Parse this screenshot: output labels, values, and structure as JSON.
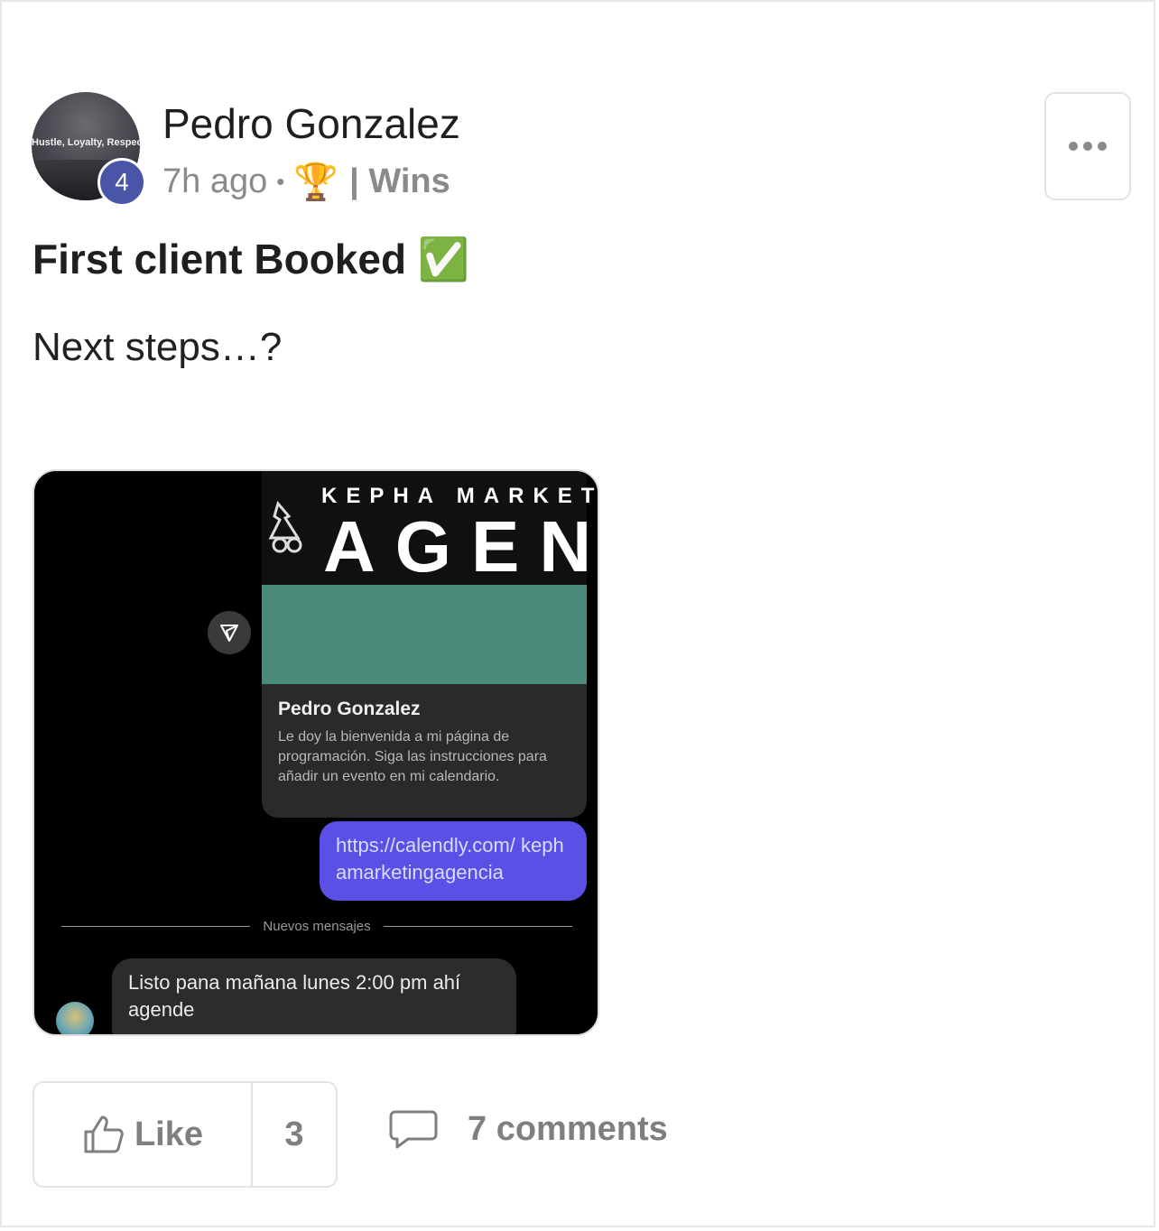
{
  "post": {
    "author": "Pedro Gonzalez",
    "avatar_text": "Hustle, Loyalty, Respect",
    "level": "4",
    "time": "7h ago",
    "separator": "•",
    "category_icon": "🏆",
    "category": "| Wins",
    "title": "First client Booked ✅",
    "body": "Next steps…?"
  },
  "attachment": {
    "banner_small": "KEPHA MARKETING",
    "banner_big": "AGENCY",
    "card_name": "Pedro Gonzalez",
    "card_desc": "Le doy la bienvenida a mi página de programación. Siga las instrucciones para añadir un evento en mi calendario.",
    "link_text": "https://calendly.com/ kephamarketingagencia",
    "divider_label": "Nuevos mensajes",
    "reply_text": "Listo pana mañana lunes 2:00 pm ahí agende",
    "colors": {
      "teal": "#4a8a7a",
      "link_bubble": "#5b50e6"
    }
  },
  "actions": {
    "like_label": "Like",
    "like_count": "3",
    "comments_label": "7 comments"
  },
  "icons": {
    "more": "more-horizontal-icon",
    "like": "thumbs-up-icon",
    "comment": "speech-bubble-icon",
    "share": "send-icon"
  },
  "colors": {
    "level_badge": "#4a55a8",
    "muted_text": "#8a8a8a"
  }
}
